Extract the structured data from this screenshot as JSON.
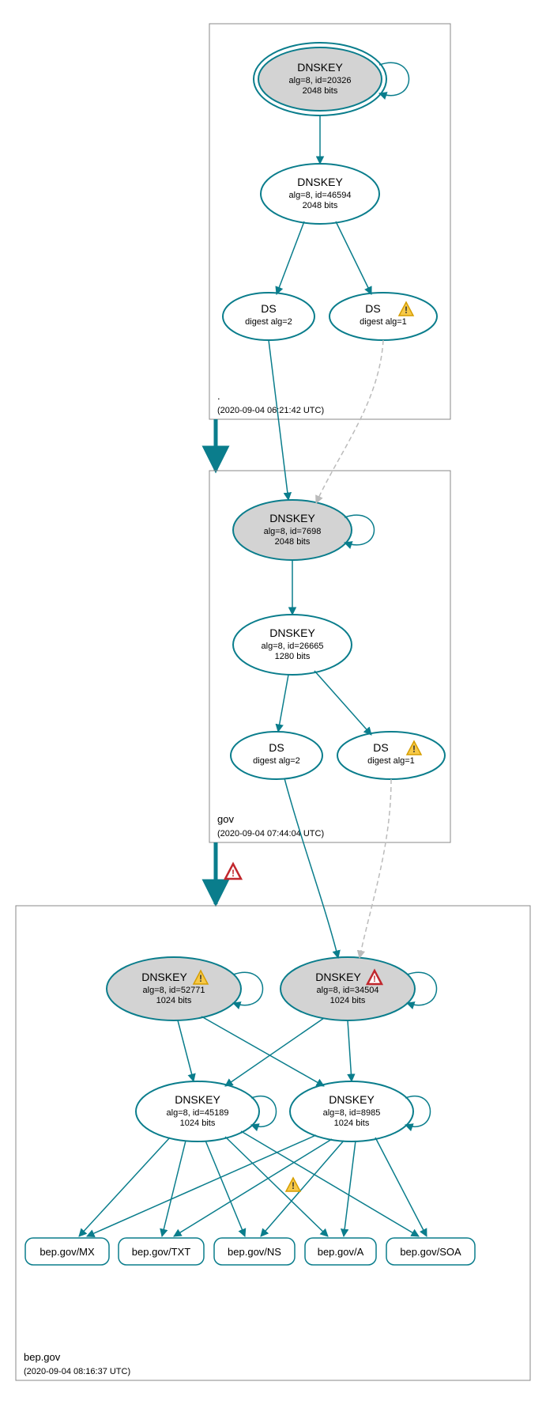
{
  "zones": {
    "root": {
      "label": ".",
      "timestamp": "(2020-09-04 06:21:42 UTC)"
    },
    "gov": {
      "label": "gov",
      "timestamp": "(2020-09-04 07:44:04 UTC)"
    },
    "bep": {
      "label": "bep.gov",
      "timestamp": "(2020-09-04 08:16:37 UTC)"
    }
  },
  "nodes": {
    "root_ksk": {
      "title": "DNSKEY",
      "line1": "alg=8, id=20326",
      "line2": "2048 bits"
    },
    "root_zsk": {
      "title": "DNSKEY",
      "line1": "alg=8, id=46594",
      "line2": "2048 bits"
    },
    "root_ds2": {
      "title": "DS",
      "line1": "digest alg=2"
    },
    "root_ds1": {
      "title": "DS",
      "line1": "digest alg=1",
      "warn": true
    },
    "gov_ksk": {
      "title": "DNSKEY",
      "line1": "alg=8, id=7698",
      "line2": "2048 bits"
    },
    "gov_zsk": {
      "title": "DNSKEY",
      "line1": "alg=8, id=26665",
      "line2": "1280 bits"
    },
    "gov_ds2": {
      "title": "DS",
      "line1": "digest alg=2"
    },
    "gov_ds1": {
      "title": "DS",
      "line1": "digest alg=1",
      "warn": true
    },
    "bep_ksk1": {
      "title": "DNSKEY",
      "line1": "alg=8, id=52771",
      "line2": "1024 bits",
      "warn": true
    },
    "bep_ksk2": {
      "title": "DNSKEY",
      "line1": "alg=8, id=34504",
      "line2": "1024 bits",
      "error": true
    },
    "bep_zsk1": {
      "title": "DNSKEY",
      "line1": "alg=8, id=45189",
      "line2": "1024 bits"
    },
    "bep_zsk2": {
      "title": "DNSKEY",
      "line1": "alg=8, id=8985",
      "line2": "1024 bits"
    },
    "leaves": {
      "mx": "bep.gov/MX",
      "txt": "bep.gov/TXT",
      "ns": "bep.gov/NS",
      "a": "bep.gov/A",
      "soa": "bep.gov/SOA"
    }
  },
  "chart_data": {
    "type": "dnssec-delegation-graph",
    "zones": [
      {
        "name": ".",
        "analyzed": "2020-09-04 06:21:42 UTC",
        "dnskeys": [
          {
            "role": "KSK",
            "alg": 8,
            "id": 20326,
            "bits": 2048,
            "trust_anchor": true,
            "self_sign": true
          },
          {
            "role": "ZSK",
            "alg": 8,
            "id": 46594,
            "bits": 2048
          }
        ],
        "ds_for_child": [
          {
            "digest_alg": 2,
            "status": "secure"
          },
          {
            "digest_alg": 1,
            "status": "warning"
          }
        ]
      },
      {
        "name": "gov",
        "analyzed": "2020-09-04 07:44:04 UTC",
        "dnskeys": [
          {
            "role": "KSK",
            "alg": 8,
            "id": 7698,
            "bits": 2048,
            "self_sign": true
          },
          {
            "role": "ZSK",
            "alg": 8,
            "id": 26665,
            "bits": 1280
          }
        ],
        "ds_for_child": [
          {
            "digest_alg": 2,
            "status": "secure"
          },
          {
            "digest_alg": 1,
            "status": "warning"
          }
        ],
        "delegation_status": "error"
      },
      {
        "name": "bep.gov",
        "analyzed": "2020-09-04 08:16:37 UTC",
        "dnskeys": [
          {
            "role": "KSK",
            "alg": 8,
            "id": 52771,
            "bits": 1024,
            "self_sign": true,
            "status": "warning"
          },
          {
            "role": "KSK",
            "alg": 8,
            "id": 34504,
            "bits": 1024,
            "self_sign": true,
            "status": "error"
          },
          {
            "role": "ZSK",
            "alg": 8,
            "id": 45189,
            "bits": 1024,
            "self_sign": true
          },
          {
            "role": "ZSK",
            "alg": 8,
            "id": 8985,
            "bits": 1024,
            "self_sign": true
          }
        ],
        "rrsets": [
          "bep.gov/MX",
          "bep.gov/TXT",
          "bep.gov/NS",
          "bep.gov/A",
          "bep.gov/SOA"
        ],
        "rrset_status": {
          "bep.gov/NS": "warning"
        }
      }
    ],
    "edges": [
      {
        "from": "root.KSK.20326",
        "to": "root.KSK.20326",
        "type": "self-loop"
      },
      {
        "from": "root.KSK.20326",
        "to": "root.ZSK.46594",
        "type": "sign"
      },
      {
        "from": "root.ZSK.46594",
        "to": "DS.digest2",
        "type": "sign"
      },
      {
        "from": "root.ZSK.46594",
        "to": "DS.digest1",
        "type": "sign"
      },
      {
        "from": "DS.digest2",
        "to": "gov.KSK.7698",
        "type": "secure"
      },
      {
        "from": "DS.digest1",
        "to": "gov.KSK.7698",
        "type": "insecure"
      },
      {
        "from": "gov.KSK.7698",
        "to": "gov.KSK.7698",
        "type": "self-loop"
      },
      {
        "from": "gov.KSK.7698",
        "to": "gov.ZSK.26665",
        "type": "sign"
      },
      {
        "from": "gov.ZSK.26665",
        "to": "DS.digest2",
        "type": "sign"
      },
      {
        "from": "gov.ZSK.26665",
        "to": "DS.digest1",
        "type": "sign"
      },
      {
        "from": "DS.digest2",
        "to": "bep.KSK.34504",
        "type": "secure"
      },
      {
        "from": "DS.digest1",
        "to": "bep.KSK.34504",
        "type": "insecure"
      },
      {
        "from": "bep.KSK.52771",
        "to": "bep.KSK.52771",
        "type": "self-loop"
      },
      {
        "from": "bep.KSK.34504",
        "to": "bep.KSK.34504",
        "type": "self-loop"
      },
      {
        "from": "bep.KSK.52771",
        "to": "bep.ZSK.45189",
        "type": "sign"
      },
      {
        "from": "bep.KSK.52771",
        "to": "bep.ZSK.8985",
        "type": "sign"
      },
      {
        "from": "bep.KSK.34504",
        "to": "bep.ZSK.45189",
        "type": "sign"
      },
      {
        "from": "bep.KSK.34504",
        "to": "bep.ZSK.8985",
        "type": "sign"
      },
      {
        "from": "bep.ZSK.45189",
        "to": "bep.ZSK.45189",
        "type": "self-loop"
      },
      {
        "from": "bep.ZSK.8985",
        "to": "bep.ZSK.8985",
        "type": "self-loop"
      },
      {
        "from": "bep.ZSK.45189",
        "to": "bep.gov/MX",
        "type": "sign"
      },
      {
        "from": "bep.ZSK.45189",
        "to": "bep.gov/TXT",
        "type": "sign"
      },
      {
        "from": "bep.ZSK.45189",
        "to": "bep.gov/NS",
        "type": "sign"
      },
      {
        "from": "bep.ZSK.45189",
        "to": "bep.gov/A",
        "type": "sign"
      },
      {
        "from": "bep.ZSK.45189",
        "to": "bep.gov/SOA",
        "type": "sign"
      },
      {
        "from": "bep.ZSK.8985",
        "to": "bep.gov/MX",
        "type": "sign"
      },
      {
        "from": "bep.ZSK.8985",
        "to": "bep.gov/TXT",
        "type": "sign"
      },
      {
        "from": "bep.ZSK.8985",
        "to": "bep.gov/NS",
        "type": "sign"
      },
      {
        "from": "bep.ZSK.8985",
        "to": "bep.gov/A",
        "type": "sign"
      },
      {
        "from": "bep.ZSK.8985",
        "to": "bep.gov/SOA",
        "type": "sign"
      }
    ]
  }
}
